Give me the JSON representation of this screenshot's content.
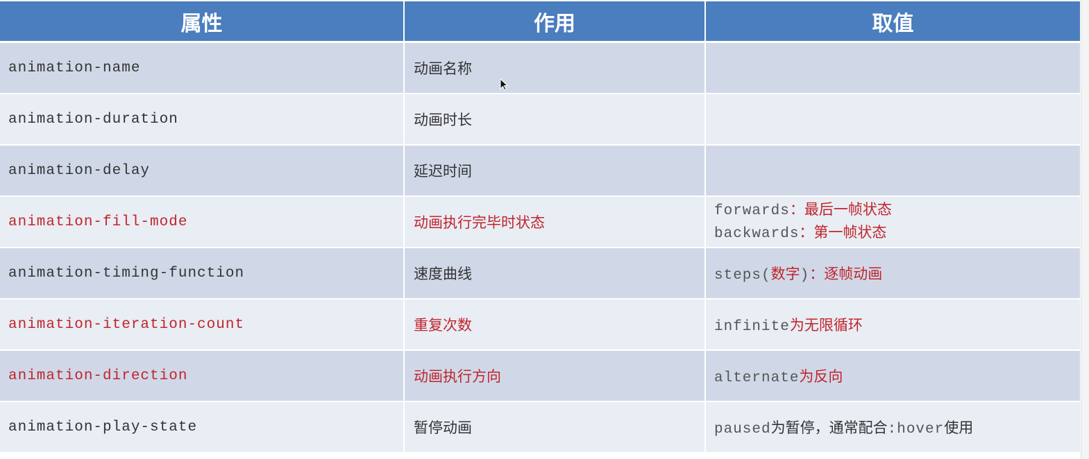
{
  "table": {
    "headers": [
      "属性",
      "作用",
      "取值"
    ],
    "rows": [
      {
        "property": "animation-name",
        "effect": "动画名称",
        "values": [],
        "highlight": false
      },
      {
        "property": "animation-duration",
        "effect": "动画时长",
        "values": [],
        "highlight": false
      },
      {
        "property": "animation-delay",
        "effect": "延迟时间",
        "values": [],
        "highlight": false
      },
      {
        "property": "animation-fill-mode",
        "effect": "动画执行完毕时状态",
        "values": [
          {
            "code": "forwards",
            "text": "：最后一帧状态"
          },
          {
            "code": "backwards",
            "text": "：第一帧状态"
          }
        ],
        "highlight": true
      },
      {
        "property": "animation-timing-function",
        "effect": "速度曲线",
        "values": [
          {
            "code": "steps(",
            "text": "数字",
            "code2": ")",
            "text2": "：逐帧动画"
          }
        ],
        "highlight": false,
        "value_highlight": true
      },
      {
        "property": "animation-iteration-count",
        "effect": "重复次数",
        "values": [
          {
            "code": "infinite",
            "text": "为无限循环"
          }
        ],
        "highlight": true
      },
      {
        "property": "animation-direction",
        "effect": "动画执行方向",
        "values": [
          {
            "code": "alternate",
            "text": "为反向"
          }
        ],
        "highlight": true
      },
      {
        "property": "animation-play-state",
        "effect": "暂停动画",
        "values": [
          {
            "code": "paused",
            "text": "为暂停，通常配合",
            "code2": ":hover",
            "text2": "使用"
          }
        ],
        "highlight": false
      }
    ]
  },
  "colors": {
    "header_bg": "#4a7ebe",
    "row_odd": "#d0d8e8",
    "row_even": "#e9edf4",
    "highlight_red": "#c0252b"
  },
  "icons": {
    "cursor": "mouse-pointer-icon"
  }
}
